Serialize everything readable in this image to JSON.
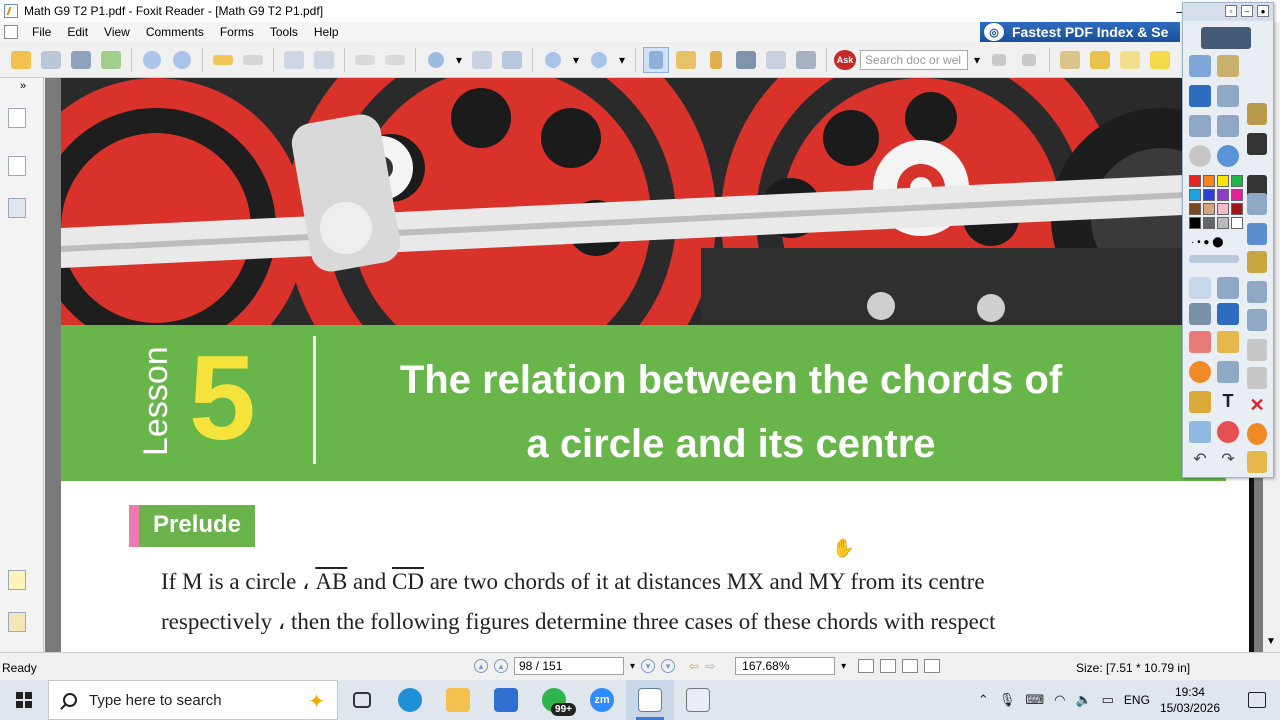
{
  "window": {
    "title": "Math G9 T2 P1.pdf - Foxit Reader - [Math G9 T2 P1.pdf]",
    "controls": [
      "–",
      "□",
      "✕"
    ]
  },
  "menu": {
    "items": [
      "File",
      "Edit",
      "View",
      "Comments",
      "Forms",
      "Tools",
      "Help"
    ]
  },
  "ad_banner": {
    "text": "Fastest PDF Index & Se"
  },
  "toolbar": {
    "search_placeholder": "Search doc or wel",
    "ask_label": "Ask"
  },
  "document": {
    "lesson_word": "Lesson",
    "lesson_number": "5",
    "lesson_title_line1": "The relation between the chords of",
    "lesson_title_line2": "a circle and its centre",
    "section_label": "Prelude",
    "body_line1_a": "If M is a circle ",
    "body_line1_comma": "،",
    "body_line1_ab": "AB",
    "body_line1_and": " and ",
    "body_line1_cd": "CD",
    "body_line1_b": " are two chords of it at distances MX and MY from its centre",
    "body_line2": "respectively ، then the following figures determine three cases of these chords with respect"
  },
  "status": {
    "ready": "Ready",
    "page_display": "98 / 151",
    "zoom": "167.68%",
    "size": "Size: [7.51 * 10.79 in]"
  },
  "taskbar": {
    "search_placeholder": "Type here to search",
    "whatsapp_badge": "99+",
    "zoom_label": "zm",
    "lang": "ENG",
    "time": "19:34",
    "date": "15/03/2026"
  },
  "colors": {
    "lesson_green": "#68b64a",
    "lesson_number_yellow": "#f5e33b",
    "prelude_pink": "#ee7bb0",
    "wheel_red": "#d8322a"
  }
}
